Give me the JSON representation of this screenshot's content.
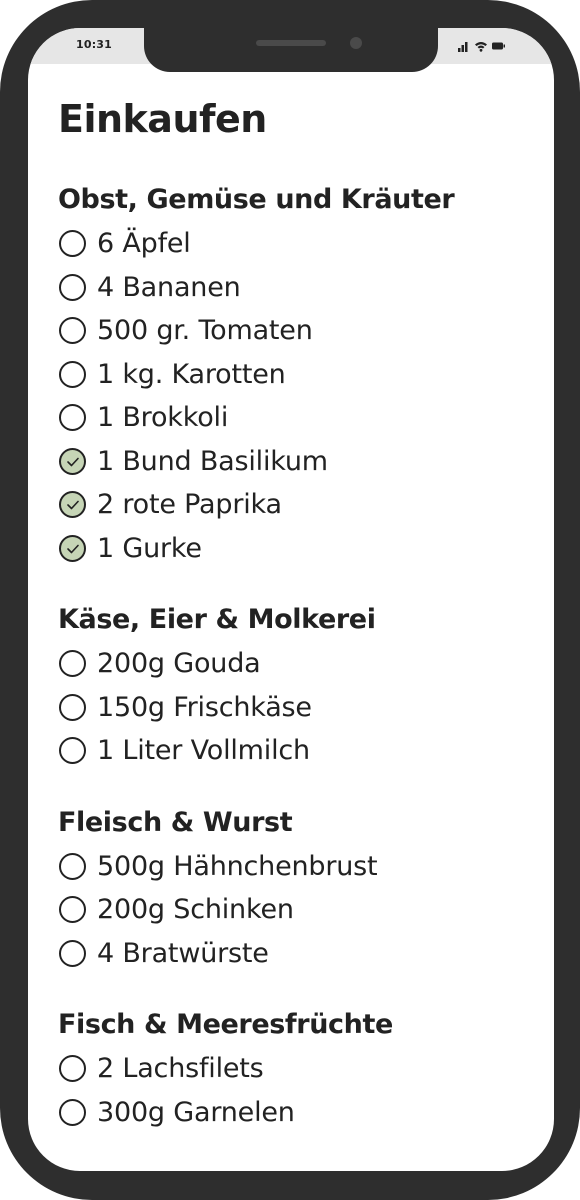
{
  "status_bar": {
    "time": "10:31",
    "icons": [
      "signal-icon",
      "wifi-icon",
      "battery-icon"
    ]
  },
  "page": {
    "title": "Einkaufen"
  },
  "colors": {
    "frame": "#2e2e2e",
    "text": "#222222",
    "checked_fill": "#c6d5b6"
  },
  "sections": [
    {
      "title": "Obst, Gemüse und Kräuter",
      "items": [
        {
          "label": "6 Äpfel",
          "checked": false
        },
        {
          "label": "4 Bananen",
          "checked": false
        },
        {
          "label": "500 gr. Tomaten",
          "checked": false
        },
        {
          "label": "1 kg. Karotten",
          "checked": false
        },
        {
          "label": "1 Brokkoli",
          "checked": false
        },
        {
          "label": "1 Bund Basilikum",
          "checked": true
        },
        {
          "label": "2 rote Paprika",
          "checked": true
        },
        {
          "label": "1 Gurke",
          "checked": true
        }
      ]
    },
    {
      "title": "Käse, Eier & Molkerei",
      "items": [
        {
          "label": "200g Gouda",
          "checked": false
        },
        {
          "label": "150g Frischkäse",
          "checked": false
        },
        {
          "label": "1 Liter Vollmilch",
          "checked": false
        }
      ]
    },
    {
      "title": "Fleisch & Wurst",
      "items": [
        {
          "label": "500g Hähnchenbrust",
          "checked": false
        },
        {
          "label": "200g Schinken",
          "checked": false
        },
        {
          "label": "4 Bratwürste",
          "checked": false
        }
      ]
    },
    {
      "title": "Fisch & Meeresfrüchte",
      "items": [
        {
          "label": "2 Lachsfilets",
          "checked": false
        },
        {
          "label": "300g Garnelen",
          "checked": false
        }
      ]
    }
  ]
}
